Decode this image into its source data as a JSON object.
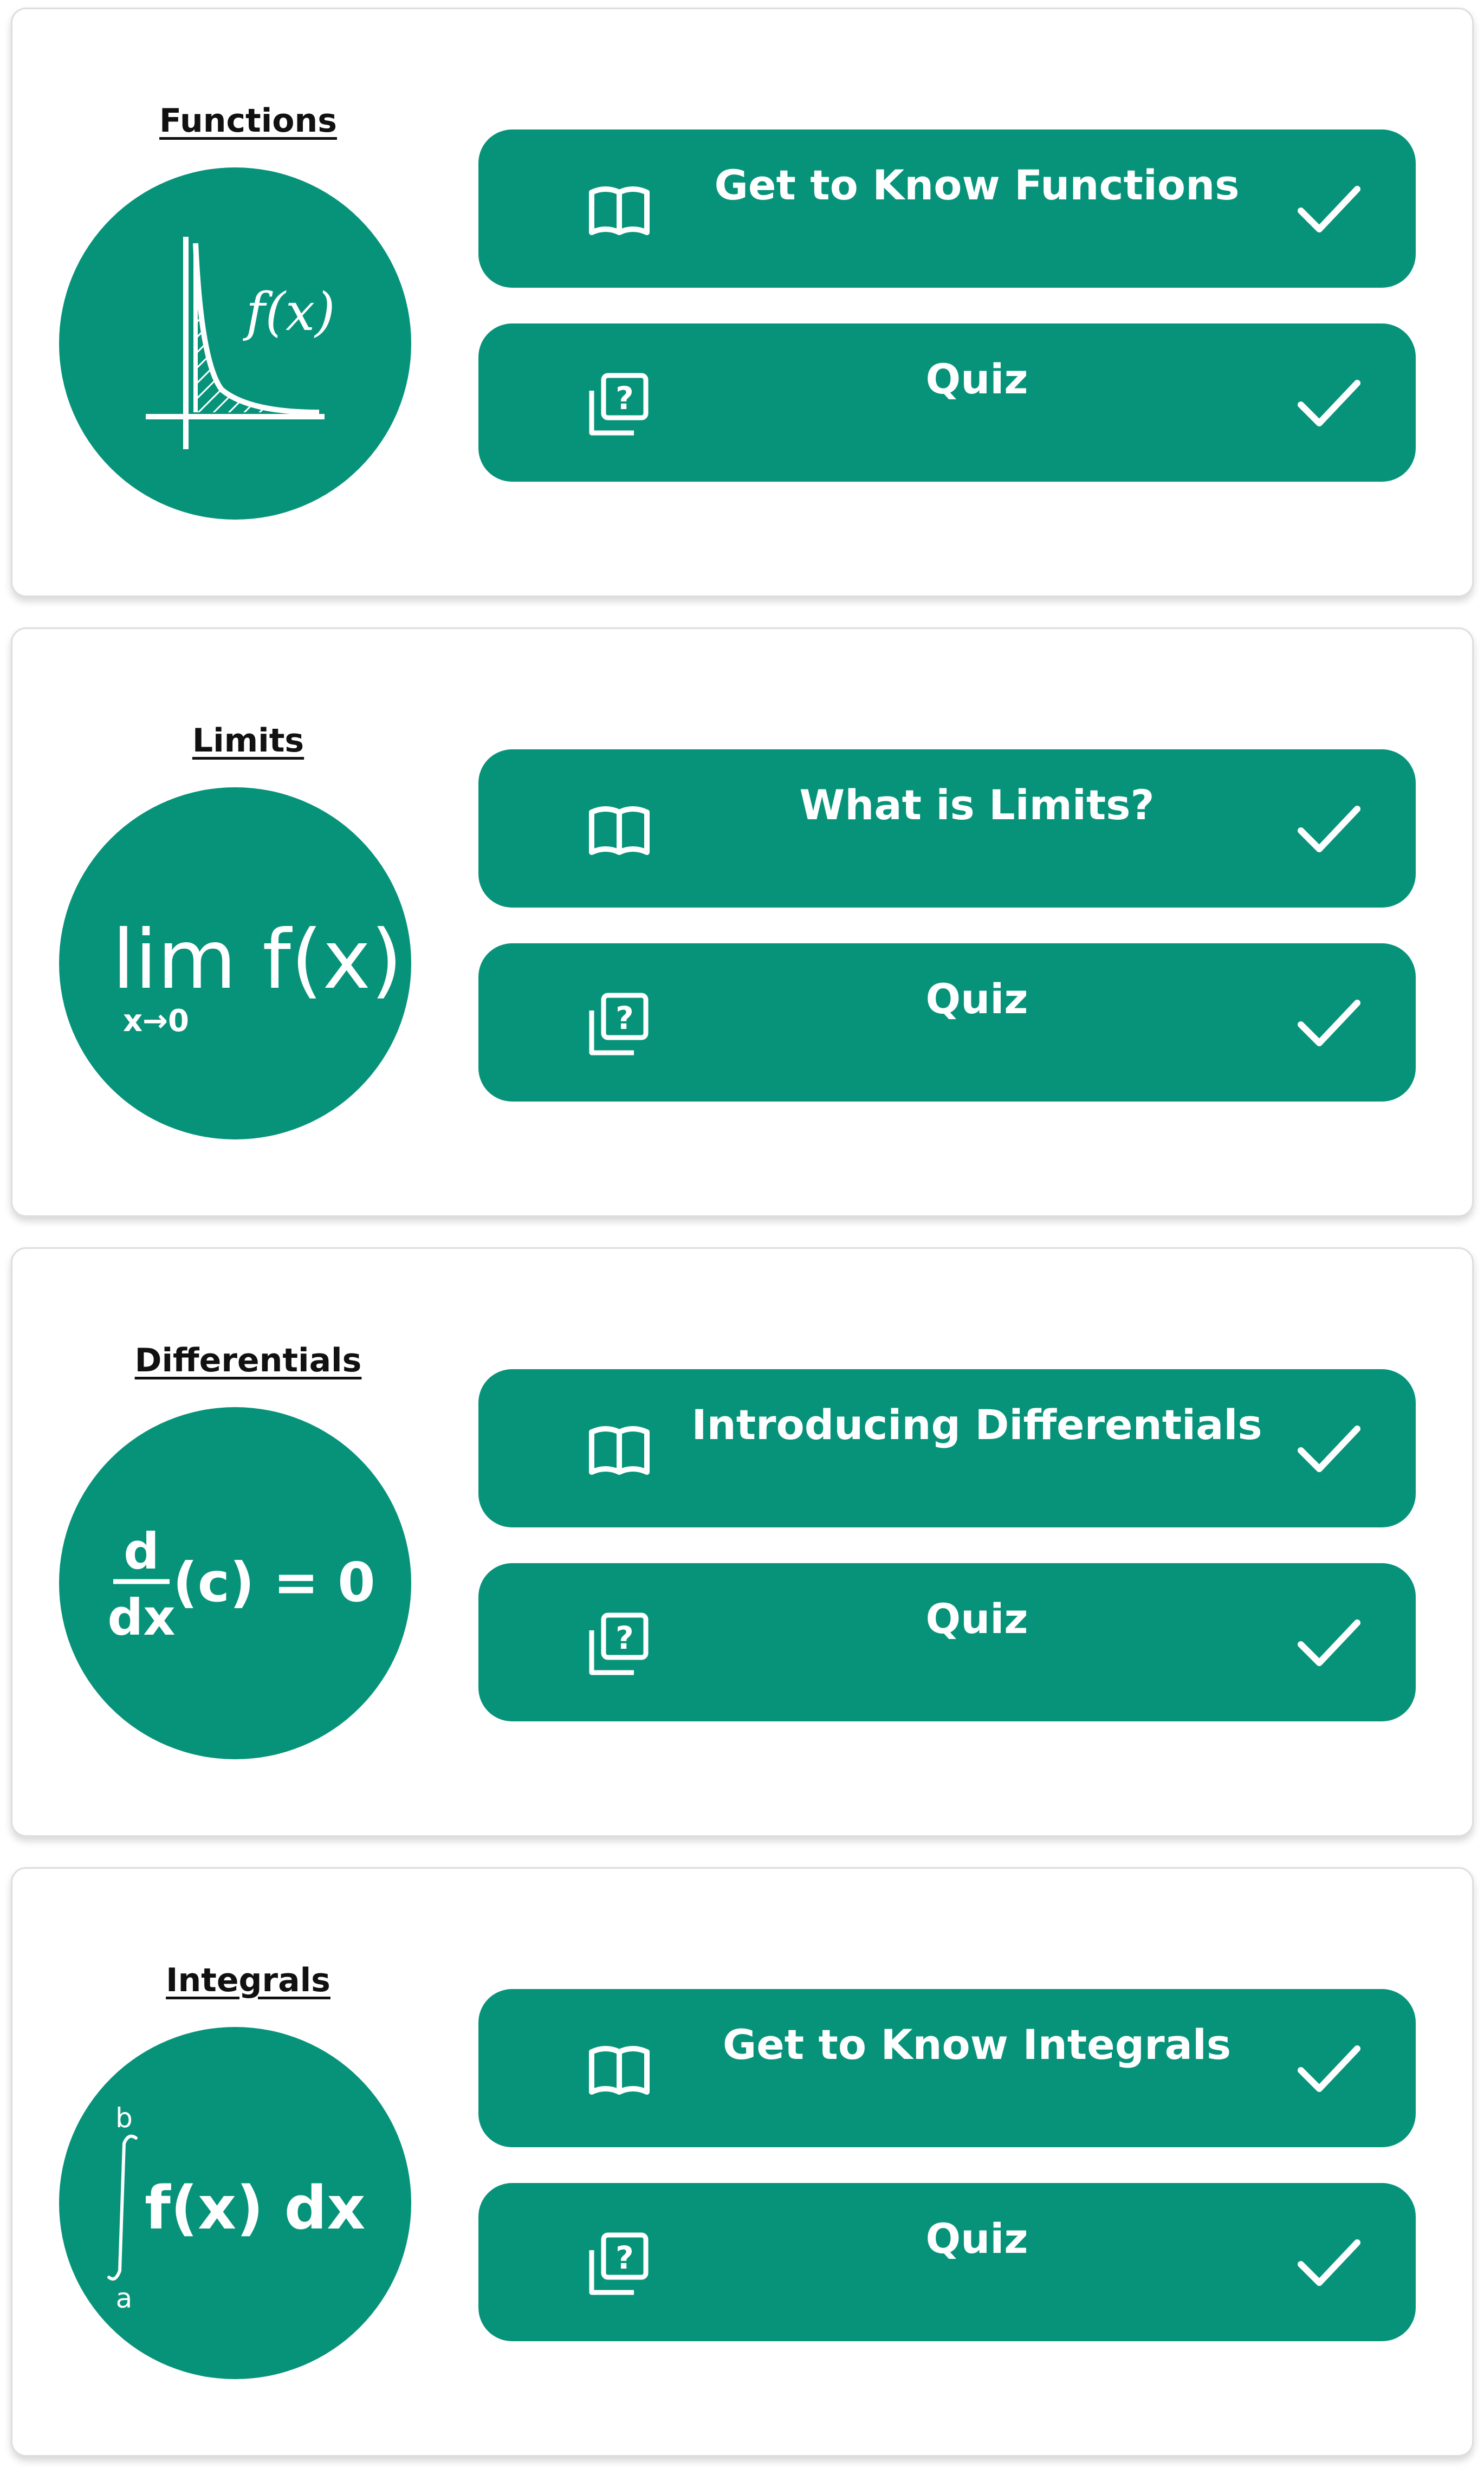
{
  "colors": {
    "accent": "#07937a",
    "text_on_accent": "#ffffff",
    "card_border": "#dedede",
    "title_text": "#111111"
  },
  "topics": [
    {
      "title": "Functions",
      "illustration": "function-graph-icon",
      "illustration_text": "f(x)",
      "lesson": {
        "label": "Get to Know Functions",
        "icon": "book-icon",
        "status_icon": "check-icon",
        "completed": true
      },
      "quiz": {
        "label": "Quiz",
        "icon": "quiz-icon",
        "status_icon": "check-icon",
        "completed": true
      }
    },
    {
      "title": "Limits",
      "illustration": "limit-formula-icon",
      "illustration_text": "lim f(x)",
      "illustration_subtext": "x→0",
      "lesson": {
        "label": "What is Limits?",
        "icon": "book-icon",
        "status_icon": "check-icon",
        "completed": true
      },
      "quiz": {
        "label": "Quiz",
        "icon": "quiz-icon",
        "status_icon": "check-icon",
        "completed": true
      }
    },
    {
      "title": "Differentials",
      "illustration": "derivative-formula-icon",
      "illustration_numerator": "d",
      "illustration_denominator": "dx",
      "illustration_text": "(c) = 0",
      "lesson": {
        "label": "Introducing Differentials",
        "icon": "book-icon",
        "status_icon": "check-icon",
        "completed": true
      },
      "quiz": {
        "label": "Quiz",
        "icon": "quiz-icon",
        "status_icon": "check-icon",
        "completed": true
      }
    },
    {
      "title": "Integrals",
      "illustration": "integral-formula-icon",
      "illustration_upper": "b",
      "illustration_lower": "a",
      "illustration_text": "f(x) dx",
      "lesson": {
        "label": "Get to Know Integrals",
        "icon": "book-icon",
        "status_icon": "check-icon",
        "completed": true
      },
      "quiz": {
        "label": "Quiz",
        "icon": "quiz-icon",
        "status_icon": "check-icon",
        "completed": true
      }
    }
  ]
}
